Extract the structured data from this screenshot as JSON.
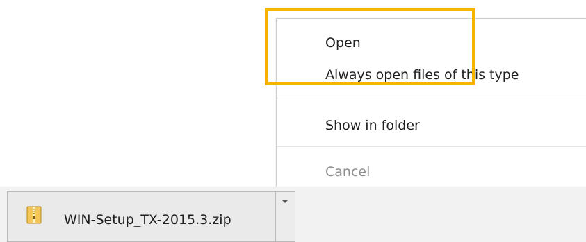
{
  "context_menu": {
    "items": [
      {
        "label": "Open",
        "enabled": true
      },
      {
        "label": "Always open files of this type",
        "enabled": true
      },
      {
        "label": "Show in folder",
        "enabled": true
      },
      {
        "label": "Cancel",
        "enabled": false
      }
    ]
  },
  "download_bar": {
    "file_name": "WIN-Setup_TX-2015.3.zip",
    "file_icon": "zip-archive-icon",
    "toggle_icon": "chevron-down-icon"
  },
  "annotation": {
    "highlight_color": "#f5b400"
  }
}
